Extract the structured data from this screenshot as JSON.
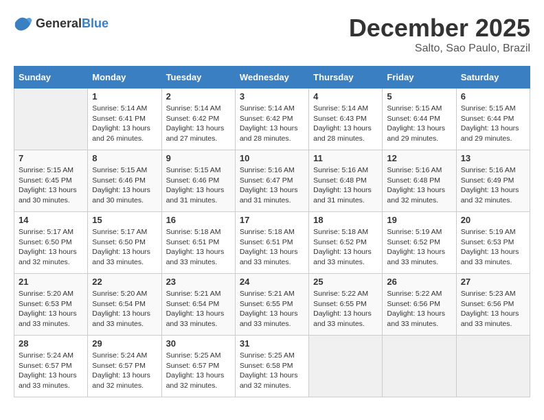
{
  "header": {
    "logo_general": "General",
    "logo_blue": "Blue",
    "month": "December 2025",
    "location": "Salto, Sao Paulo, Brazil"
  },
  "days_of_week": [
    "Sunday",
    "Monday",
    "Tuesday",
    "Wednesday",
    "Thursday",
    "Friday",
    "Saturday"
  ],
  "weeks": [
    [
      {
        "day": "",
        "empty": true
      },
      {
        "day": "1",
        "sunrise": "5:14 AM",
        "sunset": "6:41 PM",
        "daylight": "13 hours and 26 minutes."
      },
      {
        "day": "2",
        "sunrise": "5:14 AM",
        "sunset": "6:42 PM",
        "daylight": "13 hours and 27 minutes."
      },
      {
        "day": "3",
        "sunrise": "5:14 AM",
        "sunset": "6:42 PM",
        "daylight": "13 hours and 28 minutes."
      },
      {
        "day": "4",
        "sunrise": "5:14 AM",
        "sunset": "6:43 PM",
        "daylight": "13 hours and 28 minutes."
      },
      {
        "day": "5",
        "sunrise": "5:15 AM",
        "sunset": "6:44 PM",
        "daylight": "13 hours and 29 minutes."
      },
      {
        "day": "6",
        "sunrise": "5:15 AM",
        "sunset": "6:44 PM",
        "daylight": "13 hours and 29 minutes."
      }
    ],
    [
      {
        "day": "7",
        "sunrise": "5:15 AM",
        "sunset": "6:45 PM",
        "daylight": "13 hours and 30 minutes."
      },
      {
        "day": "8",
        "sunrise": "5:15 AM",
        "sunset": "6:46 PM",
        "daylight": "13 hours and 30 minutes."
      },
      {
        "day": "9",
        "sunrise": "5:15 AM",
        "sunset": "6:46 PM",
        "daylight": "13 hours and 31 minutes."
      },
      {
        "day": "10",
        "sunrise": "5:16 AM",
        "sunset": "6:47 PM",
        "daylight": "13 hours and 31 minutes."
      },
      {
        "day": "11",
        "sunrise": "5:16 AM",
        "sunset": "6:48 PM",
        "daylight": "13 hours and 31 minutes."
      },
      {
        "day": "12",
        "sunrise": "5:16 AM",
        "sunset": "6:48 PM",
        "daylight": "13 hours and 32 minutes."
      },
      {
        "day": "13",
        "sunrise": "5:16 AM",
        "sunset": "6:49 PM",
        "daylight": "13 hours and 32 minutes."
      }
    ],
    [
      {
        "day": "14",
        "sunrise": "5:17 AM",
        "sunset": "6:50 PM",
        "daylight": "13 hours and 32 minutes."
      },
      {
        "day": "15",
        "sunrise": "5:17 AM",
        "sunset": "6:50 PM",
        "daylight": "13 hours and 33 minutes."
      },
      {
        "day": "16",
        "sunrise": "5:18 AM",
        "sunset": "6:51 PM",
        "daylight": "13 hours and 33 minutes."
      },
      {
        "day": "17",
        "sunrise": "5:18 AM",
        "sunset": "6:51 PM",
        "daylight": "13 hours and 33 minutes."
      },
      {
        "day": "18",
        "sunrise": "5:18 AM",
        "sunset": "6:52 PM",
        "daylight": "13 hours and 33 minutes."
      },
      {
        "day": "19",
        "sunrise": "5:19 AM",
        "sunset": "6:52 PM",
        "daylight": "13 hours and 33 minutes."
      },
      {
        "day": "20",
        "sunrise": "5:19 AM",
        "sunset": "6:53 PM",
        "daylight": "13 hours and 33 minutes."
      }
    ],
    [
      {
        "day": "21",
        "sunrise": "5:20 AM",
        "sunset": "6:53 PM",
        "daylight": "13 hours and 33 minutes."
      },
      {
        "day": "22",
        "sunrise": "5:20 AM",
        "sunset": "6:54 PM",
        "daylight": "13 hours and 33 minutes."
      },
      {
        "day": "23",
        "sunrise": "5:21 AM",
        "sunset": "6:54 PM",
        "daylight": "13 hours and 33 minutes."
      },
      {
        "day": "24",
        "sunrise": "5:21 AM",
        "sunset": "6:55 PM",
        "daylight": "13 hours and 33 minutes."
      },
      {
        "day": "25",
        "sunrise": "5:22 AM",
        "sunset": "6:55 PM",
        "daylight": "13 hours and 33 minutes."
      },
      {
        "day": "26",
        "sunrise": "5:22 AM",
        "sunset": "6:56 PM",
        "daylight": "13 hours and 33 minutes."
      },
      {
        "day": "27",
        "sunrise": "5:23 AM",
        "sunset": "6:56 PM",
        "daylight": "13 hours and 33 minutes."
      }
    ],
    [
      {
        "day": "28",
        "sunrise": "5:24 AM",
        "sunset": "6:57 PM",
        "daylight": "13 hours and 33 minutes."
      },
      {
        "day": "29",
        "sunrise": "5:24 AM",
        "sunset": "6:57 PM",
        "daylight": "13 hours and 32 minutes."
      },
      {
        "day": "30",
        "sunrise": "5:25 AM",
        "sunset": "6:57 PM",
        "daylight": "13 hours and 32 minutes."
      },
      {
        "day": "31",
        "sunrise": "5:25 AM",
        "sunset": "6:58 PM",
        "daylight": "13 hours and 32 minutes."
      },
      {
        "day": "",
        "empty": true
      },
      {
        "day": "",
        "empty": true
      },
      {
        "day": "",
        "empty": true
      }
    ]
  ]
}
